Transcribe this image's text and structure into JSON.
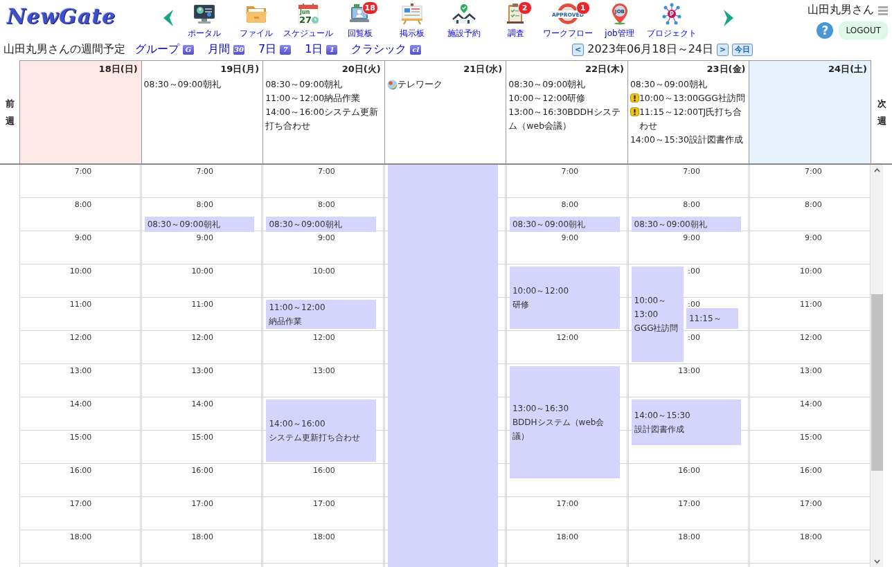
{
  "logo": "NewGate",
  "nav": {
    "items": [
      {
        "kind": "portal",
        "label": "ポータル"
      },
      {
        "kind": "file",
        "label": "ファイル"
      },
      {
        "kind": "calendar",
        "label": "スケジュール",
        "icon_text": [
          "Jun",
          "27"
        ]
      },
      {
        "kind": "circular",
        "label": "回覧板",
        "badge": "18"
      },
      {
        "kind": "board",
        "label": "掲示板"
      },
      {
        "kind": "facility",
        "label": "施設予約"
      },
      {
        "kind": "survey",
        "label": "調査",
        "badge": "2"
      },
      {
        "kind": "workflow",
        "label": "ワークフロー",
        "badge": "1",
        "icon_text": [
          "APPROVED"
        ]
      },
      {
        "kind": "job",
        "label": "job管理",
        "icon_text": [
          "JOB"
        ]
      },
      {
        "kind": "project",
        "label": "プロジェクト",
        "icon_text": [
          "P"
        ]
      }
    ]
  },
  "user": {
    "name": "山田丸男さん",
    "help": "?",
    "logout": "LOGOUT"
  },
  "toolbar": {
    "title": "山田丸男さんの週間予定",
    "views": [
      {
        "label": "グループ",
        "icon_text": "G"
      },
      {
        "label": "月間",
        "icon_text": "30"
      },
      {
        "label": "7日",
        "icon_text": "7"
      },
      {
        "label": "1日",
        "icon_text": "1"
      },
      {
        "label": "クラシック",
        "icon_text": "cl"
      }
    ],
    "prev": "<",
    "range": "2023年06月18日～24日",
    "next": ">",
    "today": "今日"
  },
  "week": {
    "prev": "前週",
    "next": "次週",
    "days": [
      {
        "label": "18日(日)",
        "color": "#fde8e8",
        "all_day": false,
        "time_labels": [
          "7:00",
          "8:00",
          "9:00",
          "10:00",
          "11:00",
          "12:00",
          "13:00",
          "14:00",
          "15:00",
          "16:00",
          "17:00",
          "18:00"
        ]
      },
      {
        "label": "19日(月)",
        "color": "#ffffff",
        "all_day": false,
        "items": [
          {
            "kind": "plain",
            "text": "08:30～09:00朝礼"
          }
        ],
        "time_labels": [
          "7:00",
          "8:00",
          "9:00",
          "10:00",
          "11:00",
          "12:00",
          "13:00",
          "14:00",
          "15:00",
          "16:00",
          "17:00",
          "18:00"
        ],
        "events": [
          {
            "time": "08:30～09:00",
            "title": "朝礼"
          }
        ]
      },
      {
        "label": "20日(火)",
        "color": "#ffffff",
        "all_day": false,
        "items": [
          {
            "kind": "plain",
            "text": "08:30～09:00朝礼"
          },
          {
            "kind": "plain",
            "text": "11:00～12:00納品作業"
          },
          {
            "kind": "plain",
            "text": "14:00～16:00システム更新打ち合わせ"
          }
        ],
        "time_labels": [
          "7:00",
          "8:00",
          "9:00",
          "10:00",
          "12:00",
          "13:00",
          "16:00",
          "17:00",
          "18:00"
        ],
        "events": [
          {
            "time": "08:30～09:00",
            "title": "朝礼"
          },
          {
            "time": "11:00～12:00",
            "title": "納品作業"
          },
          {
            "time": "14:00～16:00",
            "title": "システム更新打ち合わせ"
          }
        ]
      },
      {
        "label": "21日(水)",
        "color": "#ffffff",
        "all_day": true,
        "items": [
          {
            "kind": "telework",
            "text": "テレワーク"
          }
        ]
      },
      {
        "label": "22日(木)",
        "color": "#ffffff",
        "all_day": false,
        "items": [
          {
            "kind": "plain",
            "text": "08:30～09:00朝礼"
          },
          {
            "kind": "plain",
            "text": "10:00～12:00研修"
          },
          {
            "kind": "plain",
            "text": "13:00～16:30BDDHシステム（web会議）"
          }
        ],
        "time_labels": [
          "7:00",
          "8:00",
          "9:00",
          "12:00",
          "17:00",
          "18:00"
        ],
        "events": [
          {
            "time": "08:30～09:00",
            "title": "朝礼"
          },
          {
            "time": "10:00～12:00",
            "title": "研修"
          },
          {
            "time": "13:00～16:30",
            "title": "BDDHシステム（web会議）"
          }
        ]
      },
      {
        "label": "23日(金)",
        "color": "#ffffff",
        "all_day": false,
        "items": [
          {
            "kind": "plain",
            "text": "08:30～09:00朝礼"
          },
          {
            "kind": "alert",
            "text": "10:00～13:00GGG社訪問"
          },
          {
            "kind": "alert",
            "text": "11:15～12:00TJ氏打ち合わせ"
          },
          {
            "kind": "plain",
            "text": "14:00～15:30設計図書作成"
          }
        ],
        "time_labels": [
          "7:00",
          "8:00",
          "9:00",
          ":00",
          ":00",
          ":00",
          "13:00",
          "16:00",
          "17:00",
          "18:00"
        ],
        "events": [
          {
            "time": "08:30～09:00",
            "title": "朝礼"
          },
          {
            "time": "10:00～13:00",
            "title": "GGG社訪問"
          },
          {
            "time": "11:15～"
          },
          {
            "time": "14:00～15:30",
            "title": "設計図書作成"
          }
        ]
      },
      {
        "label": "24日(土)",
        "color": "#e8f2fd",
        "all_day": false,
        "time_labels": [
          "7:00",
          "8:00",
          "9:00",
          "10:00",
          "11:00",
          "12:00",
          "13:00",
          "14:00",
          "15:00",
          "16:00",
          "17:00",
          "18:00"
        ]
      }
    ]
  }
}
